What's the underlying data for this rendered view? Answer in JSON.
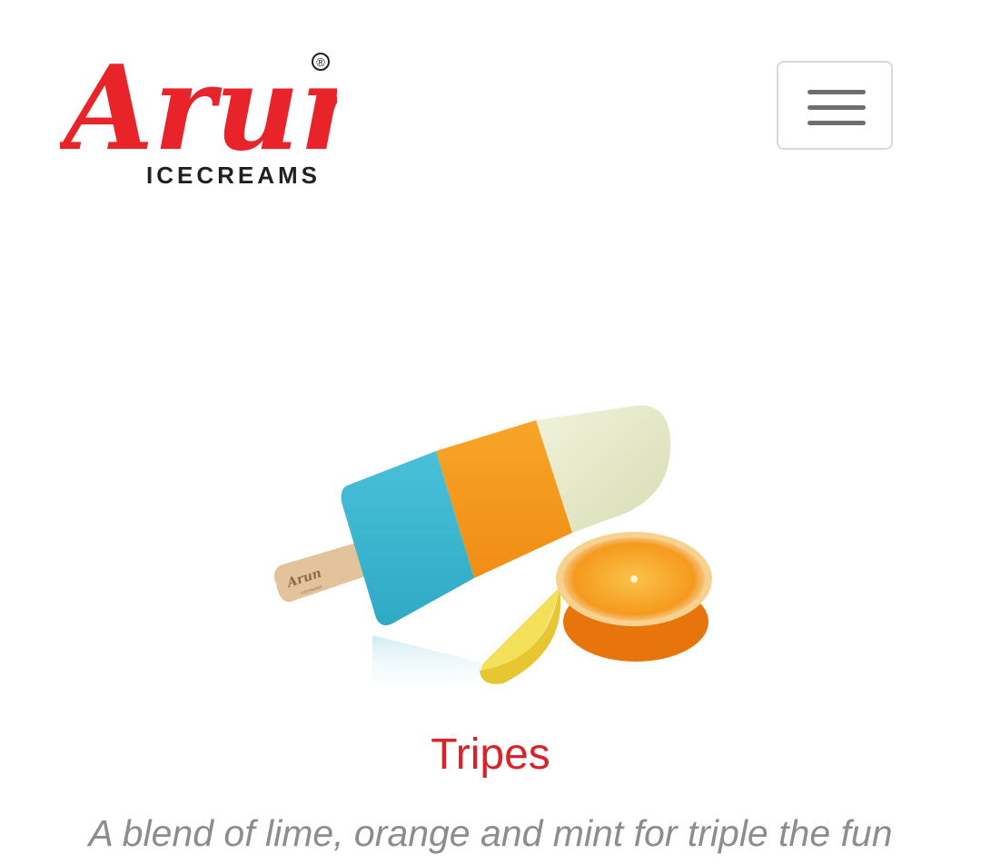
{
  "header": {
    "logo": {
      "brand": "Arun",
      "registered_mark": "®",
      "subtitle": "ICECREAMS"
    },
    "menu_button_icon": "hamburger-menu-icon"
  },
  "product": {
    "title": "Tripes",
    "description": "A blend of lime, orange and mint for triple the fun",
    "image_stick_brand": "Arun",
    "image_stick_sub": "ICECREAMS"
  },
  "colors": {
    "brand_red": "#e8232a",
    "title_red": "#d8232a",
    "description_gray": "#8d8d8d",
    "menu_border": "#d9d9d9",
    "menu_bars": "#6e6e6e",
    "bar_blue": "#3cb5cf",
    "bar_orange": "#f59a1e",
    "bar_mint": "#e7ebc8",
    "stick": "#e3c39b"
  }
}
